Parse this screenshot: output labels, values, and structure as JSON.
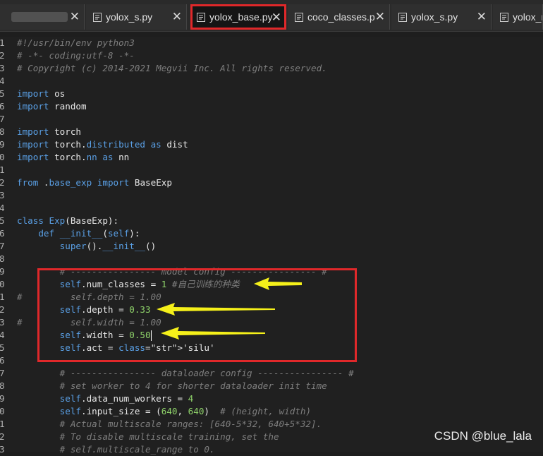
{
  "tabs": [
    {
      "label": "",
      "blurred": true,
      "active": false
    },
    {
      "label": "yolox_s.py",
      "active": false
    },
    {
      "label": "yolox_base.py",
      "active": true
    },
    {
      "label": "coco_classes.p",
      "active": false
    },
    {
      "label": "yolox_s.py",
      "active": false
    },
    {
      "label": "yolox_n",
      "active": false
    }
  ],
  "close_glyph": "✕",
  "editor": {
    "lines": [
      {
        "n": "1",
        "t": "#!/usr/bin/env python3"
      },
      {
        "n": "2",
        "t": "# -*- coding:utf-8 -*-"
      },
      {
        "n": "3",
        "t": "# Copyright (c) 2014-2021 Megvii Inc. All rights reserved."
      },
      {
        "n": "4",
        "t": ""
      },
      {
        "n": "5",
        "t": "import os"
      },
      {
        "n": "6",
        "t": "import random"
      },
      {
        "n": "7",
        "t": ""
      },
      {
        "n": "8",
        "t": "import torch"
      },
      {
        "n": "9",
        "t": "import torch.distributed as dist"
      },
      {
        "n": "0",
        "t": "import torch.nn as nn"
      },
      {
        "n": "1",
        "t": ""
      },
      {
        "n": "2",
        "t": "from .base_exp import BaseExp"
      },
      {
        "n": "3",
        "t": ""
      },
      {
        "n": "4",
        "t": ""
      },
      {
        "n": "5",
        "t": "class Exp(BaseExp):"
      },
      {
        "n": "6",
        "t": "    def __init__(self):"
      },
      {
        "n": "7",
        "t": "        super().__init__()"
      },
      {
        "n": "8",
        "t": ""
      },
      {
        "n": "9",
        "t": "        # ---------------- model config ---------------- #"
      },
      {
        "n": "0",
        "t": "        self.num_classes = 1 #自己训练的种类"
      },
      {
        "n": "1",
        "t": "#         self.depth = 1.00"
      },
      {
        "n": "2",
        "t": "        self.depth = 0.33"
      },
      {
        "n": "3",
        "t": "#         self.width = 1.00"
      },
      {
        "n": "4",
        "t": "        self.width = 0.50"
      },
      {
        "n": "5",
        "t": "        self.act = 'silu'"
      },
      {
        "n": "6",
        "t": ""
      },
      {
        "n": "7",
        "t": "        # ---------------- dataloader config ---------------- #"
      },
      {
        "n": "8",
        "t": "        # set worker to 4 for shorter dataloader init time"
      },
      {
        "n": "9",
        "t": "        self.data_num_workers = 4"
      },
      {
        "n": "0",
        "t": "        self.input_size = (640, 640)  # (height, width)"
      },
      {
        "n": "1",
        "t": "        # Actual multiscale ranges: [640-5*32, 640+5*32]."
      },
      {
        "n": "2",
        "t": "        # To disable multiscale training, set the"
      },
      {
        "n": "3",
        "t": "        # self.multiscale_range to 0."
      }
    ]
  },
  "watermark": "CSDN @blue_lala",
  "colors": {
    "highlight": "#e0282a",
    "arrow": "#f5f01a"
  }
}
